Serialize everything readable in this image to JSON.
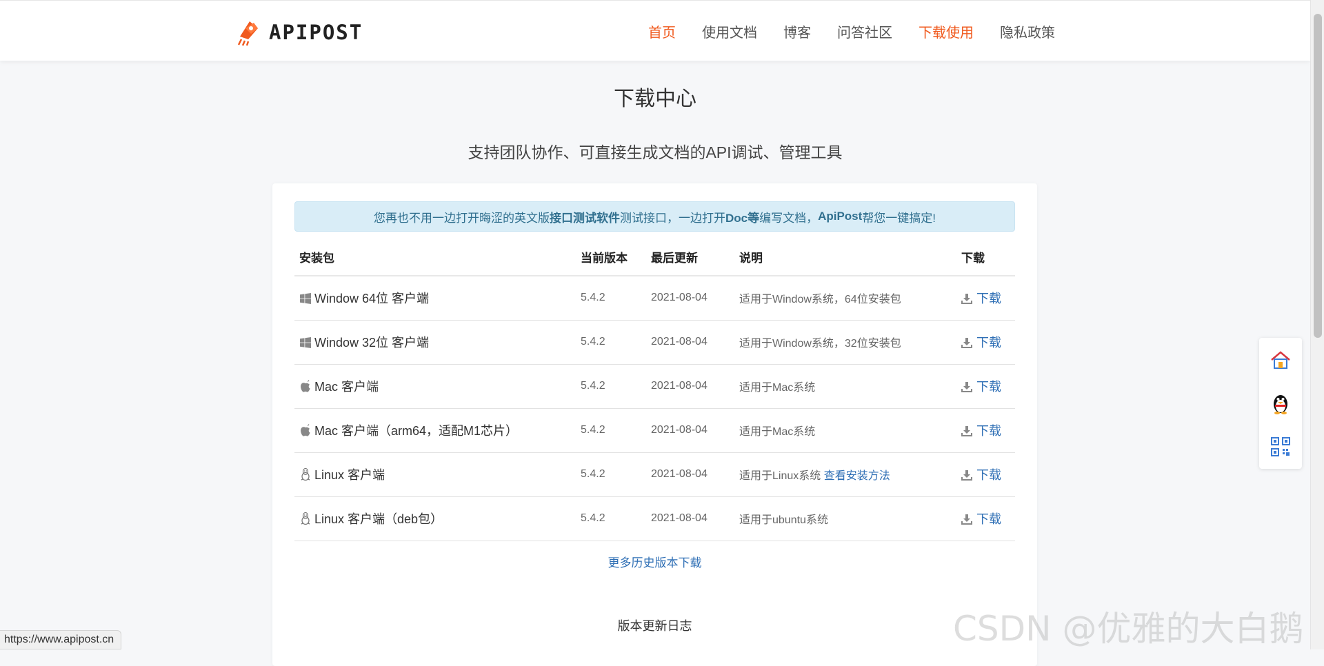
{
  "header": {
    "logo_text": "APIPOST",
    "nav": [
      {
        "label": "首页",
        "active": true
      },
      {
        "label": "使用文档",
        "active": false
      },
      {
        "label": "博客",
        "active": false
      },
      {
        "label": "问答社区",
        "active": false
      },
      {
        "label": "下载使用",
        "active": true
      },
      {
        "label": "隐私政策",
        "active": false
      }
    ]
  },
  "page": {
    "title": "下载中心",
    "subtitle": "支持团队协作、可直接生成文档的API调试、管理工具"
  },
  "notice": {
    "part1": "您再也不用一边打开晦涩的英文版",
    "bold1": "接口测试软件",
    "part2": "测试接口，一边打开",
    "bold2": "Doc等",
    "part3": "编写文档，",
    "bold3": "ApiPost",
    "part4": "帮您一键搞定!"
  },
  "table": {
    "headers": {
      "package": "安装包",
      "version": "当前版本",
      "updated": "最后更新",
      "description": "说明",
      "download": "下载"
    },
    "rows": [
      {
        "icon": "windows-icon",
        "name": "Window 64位 客户端",
        "version": "5.4.2",
        "updated": "2021-08-04",
        "desc": "适用于Window系统，64位安装包",
        "desc_link": "",
        "download": "下载"
      },
      {
        "icon": "windows-icon",
        "name": "Window 32位 客户端",
        "version": "5.4.2",
        "updated": "2021-08-04",
        "desc": "适用于Window系统，32位安装包",
        "desc_link": "",
        "download": "下载"
      },
      {
        "icon": "apple-icon",
        "name": "Mac 客户端",
        "version": "5.4.2",
        "updated": "2021-08-04",
        "desc": "适用于Mac系统",
        "desc_link": "",
        "download": "下载"
      },
      {
        "icon": "apple-icon",
        "name": "Mac 客户端（arm64，适配M1芯片）",
        "version": "5.4.2",
        "updated": "2021-08-04",
        "desc": "适用于Mac系统",
        "desc_link": "",
        "download": "下载"
      },
      {
        "icon": "linux-icon",
        "name": "Linux 客户端",
        "version": "5.4.2",
        "updated": "2021-08-04",
        "desc": "适用于Linux系统",
        "desc_link": "查看安装方法",
        "download": "下载"
      },
      {
        "icon": "linux-icon",
        "name": "Linux 客户端（deb包）",
        "version": "5.4.2",
        "updated": "2021-08-04",
        "desc": "适用于ubuntu系统",
        "desc_link": "",
        "download": "下载"
      }
    ]
  },
  "more_link": "更多历史版本下载",
  "changelog_title": "版本更新日志",
  "status_url": "https://www.apipost.cn",
  "watermark": "CSDN @优雅的大白鹅",
  "colors": {
    "accent": "#f05a1e",
    "link": "#2f6fb5",
    "notice_bg": "#d9edf7",
    "notice_text": "#31708f"
  }
}
